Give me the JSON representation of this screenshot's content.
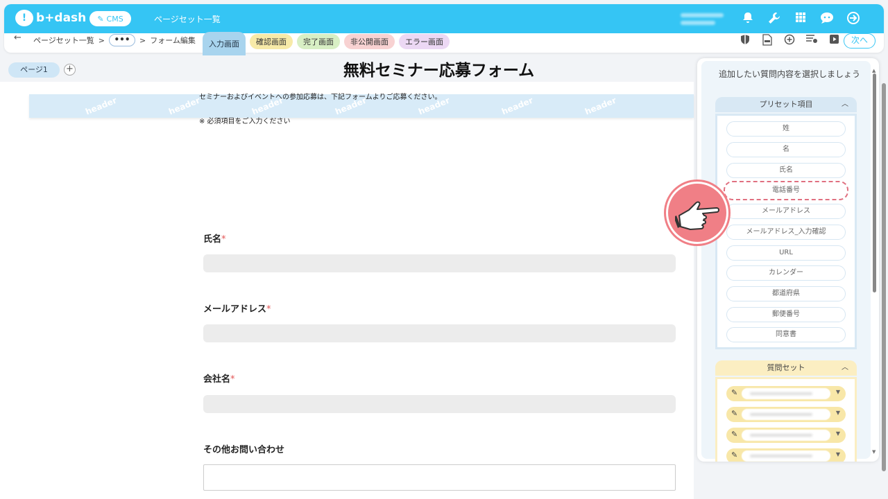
{
  "header": {
    "logo_text": "b+dash",
    "logo_mark": "!",
    "cms_label": "CMS",
    "app_title": "ページセット一覧",
    "icons": [
      "bell-icon",
      "wrench-icon",
      "grid-icon",
      "chat-bot-icon",
      "logout-icon"
    ]
  },
  "toolbar": {
    "back": "←",
    "crumb_1": "ページセット一覧",
    "sep": ">",
    "ellipsis": "•••",
    "crumb_2": "フォーム編集",
    "tabs": [
      {
        "label": "入力画面"
      },
      {
        "label": "確認画面"
      },
      {
        "label": "完了画面"
      },
      {
        "label": "非公開画面"
      },
      {
        "label": "エラー画面"
      }
    ],
    "right_icons": [
      "shield-icon",
      "html-file-icon",
      "plus-circle-icon",
      "list-settings-icon",
      "play-icon"
    ],
    "next_label": "次へ"
  },
  "page_tabs": {
    "page_label": "ページ1",
    "add": "+"
  },
  "canvas": {
    "header_watermark": "header",
    "title": "無料セミナー応募フォーム",
    "description": "セミナーおよびイベントへの参加応募は、下記フォームよりご応募ください。",
    "note": "※ 必須項目をご入力ください",
    "fields": [
      {
        "label": "氏名",
        "required_mark": "*"
      },
      {
        "label": "メールアドレス",
        "required_mark": "*"
      },
      {
        "label": "会社名",
        "required_mark": "*"
      },
      {
        "label": "その他お問い合わせ",
        "required_mark": ""
      }
    ]
  },
  "panel": {
    "title": "追加したい質問内容を選択しましょう",
    "preset_heading": "プリセット項目",
    "presets": [
      "姓",
      "名",
      "氏名",
      "電話番号",
      "メールアドレス",
      "メールアドレス_入力確認",
      "URL",
      "カレンダー",
      "都道府県",
      "郵便番号",
      "同意書"
    ],
    "highlighted_preset": "電話番号",
    "qset_heading": "質問セット",
    "collapse_icon": "^"
  },
  "colors": {
    "brand": "#35c5f4",
    "highlight": "#e07080",
    "pointer": "#f07f86"
  }
}
